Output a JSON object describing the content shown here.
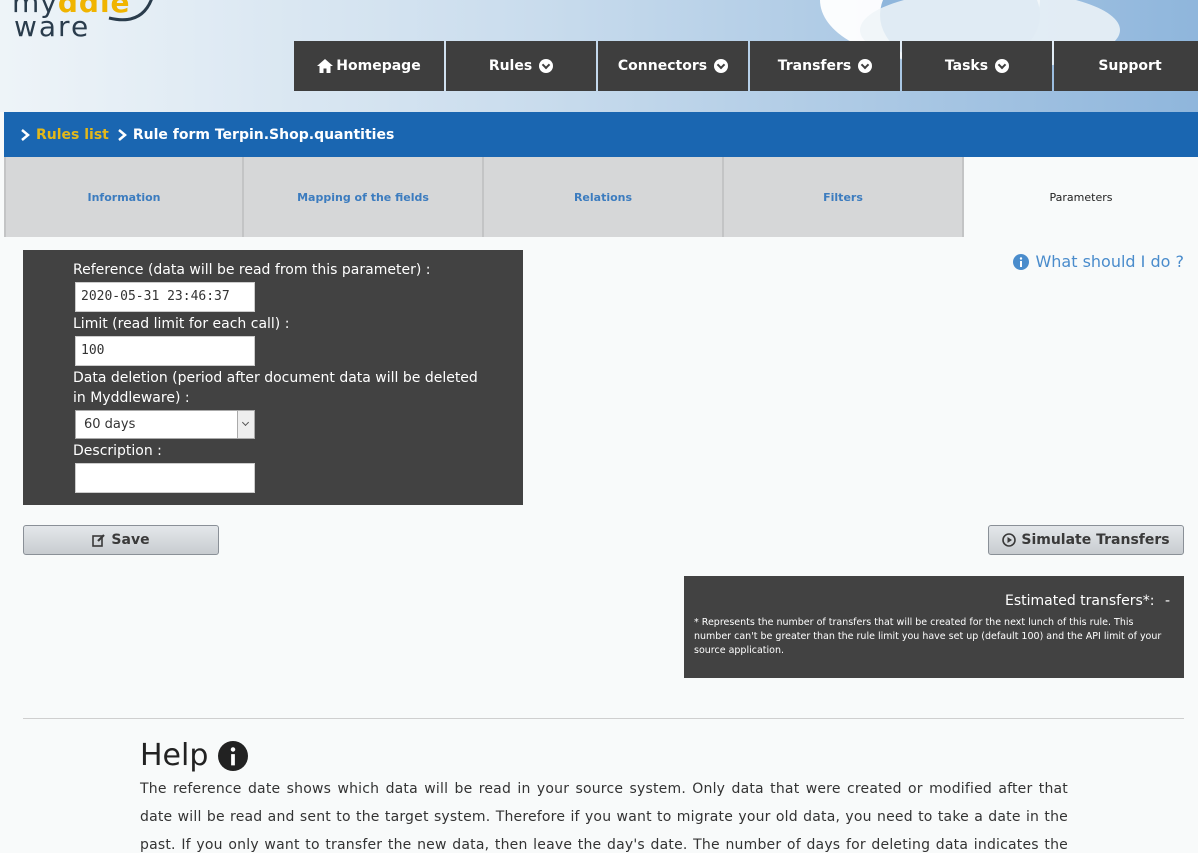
{
  "logo": {
    "line1_prefix": "my",
    "line1_accent": "ddle",
    "line2": "ware"
  },
  "nav": [
    {
      "label": "Homepage",
      "icon": "home-icon"
    },
    {
      "label": "Rules",
      "icon": "chevron-down-icon"
    },
    {
      "label": "Connectors",
      "icon": "chevron-down-icon"
    },
    {
      "label": "Transfers",
      "icon": "chevron-down-icon"
    },
    {
      "label": "Tasks",
      "icon": "chevron-down-icon"
    },
    {
      "label": "Support"
    }
  ],
  "breadcrumb": {
    "link": "Rules list",
    "current": "Rule form Terpin.Shop.quantities"
  },
  "tabs": [
    "Information",
    "Mapping of the fields",
    "Relations",
    "Filters",
    "Parameters"
  ],
  "active_tab": "Parameters",
  "form": {
    "reference_label": "Reference (data will be read from this parameter) :",
    "reference_value": "2020-05-31 23:46:37",
    "limit_label": "Limit (read limit for each call) :",
    "limit_value": "100",
    "deletion_label_1": "Data deletion (period after document data will be deleted",
    "deletion_label_2": "in Myddleware) :",
    "deletion_value": "60 days",
    "description_label": "Description :",
    "description_value": ""
  },
  "what_link": "What should I do ?",
  "buttons": {
    "save": "Save",
    "simulate": "Simulate Transfers"
  },
  "estimate": {
    "title": "Estimated transfers*:",
    "value": "-",
    "note": "* Represents the number of transfers that will be created for the next lunch of this rule. This number can't be greater than the rule limit you have set up (default 100) and the API limit of your source application."
  },
  "help": {
    "title": "Help",
    "text": "The reference date shows which data will be read in your source system. Only data that were created or modified after that date will be read and sent to the target system. Therefore if you want to migrate your old data, you need to take a date in the past. If you only want to transfer the new data, then leave the day's date. The number of days for deleting data indicates the number of days your data has"
  },
  "colors": {
    "nav_bg": "#3e3e3e",
    "breadcrumb_bg": "#1a66b1",
    "breadcrumb_link": "#e3b81a",
    "tab_link": "#3c7cbf",
    "panel_bg": "#424242",
    "help_link": "#4a8ccc"
  }
}
